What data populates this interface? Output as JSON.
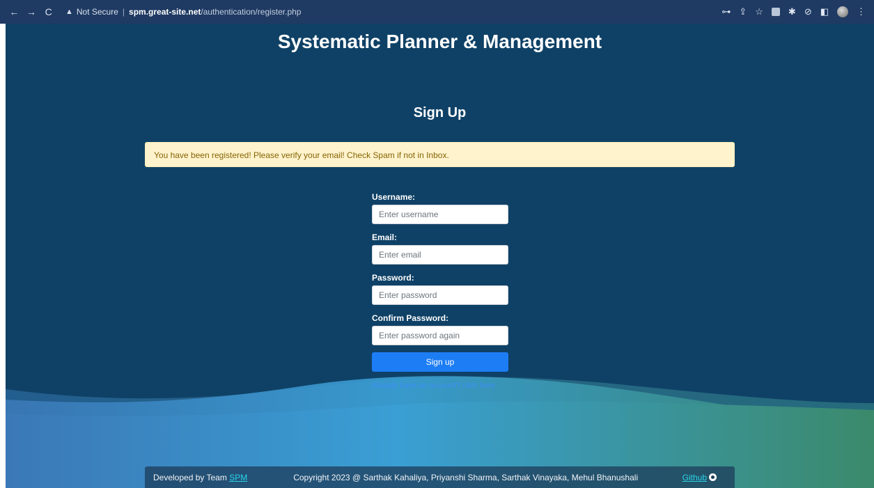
{
  "browser": {
    "back": "←",
    "forward": "→",
    "reload": "C",
    "security_icon": "warning-triangle-icon",
    "security_label": "Not Secure",
    "url_host": "spm.great-site.net",
    "url_path": "/authentication/register.php",
    "toolbar_icons": [
      "key-icon",
      "share-icon",
      "star-icon",
      "extension-icon",
      "puzzle-icon",
      "sync-icon",
      "sidebar-icon",
      "profile-avatar",
      "menu-icon"
    ]
  },
  "site": {
    "title": "Systematic Planner & Management"
  },
  "form": {
    "title": "Sign Up",
    "alert": "You have been registered! Please verify your email! Check Spam if not in Inbox.",
    "username_label": "Username:",
    "username_placeholder": "Enter username",
    "email_label": "Email:",
    "email_placeholder": "Enter email",
    "password_label": "Password:",
    "password_placeholder": "Enter password",
    "confirm_label": "Confirm Password:",
    "confirm_placeholder": "Enter password again",
    "submit_label": "Sign up",
    "login_link": "Already have an account? click here"
  },
  "footer": {
    "developed_by": "Developed by Team ",
    "team": "SPM",
    "copyright": "Copyright 2023 @ Sarthak Kahaliya, Priyanshi Sharma, Sarthak Vinayaka, Mehul Bhanushali",
    "github": "Github"
  },
  "colors": {
    "page_bg": "#0f4166",
    "accent": "#1d7df5",
    "alert_bg": "#fff3cd",
    "footer_link": "#29d4e8"
  }
}
